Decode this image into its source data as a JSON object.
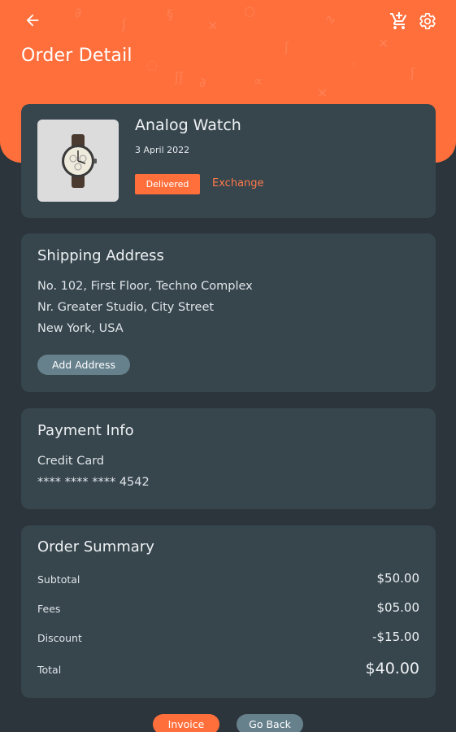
{
  "header": {
    "title": "Order Detail",
    "back_icon": "arrow-left-icon",
    "cart_icon": "cart-plus-icon",
    "settings_icon": "gear-icon",
    "accent_color": "#ff6f3c"
  },
  "product": {
    "name": "Analog Watch",
    "date": "3 April 2022",
    "status": "Delivered",
    "exchange_label": "Exchange",
    "image_icon": "watch-image"
  },
  "shipping": {
    "title": "Shipping Address",
    "lines": [
      "No. 102, First Floor, Techno Complex",
      "Nr. Greater Studio, City Street",
      "New York, USA"
    ],
    "add_address_label": "Add Address"
  },
  "payment": {
    "title": "Payment Info",
    "method": "Credit Card",
    "card_number": "**** **** **** 4542"
  },
  "summary": {
    "title": "Order Summary",
    "rows": [
      {
        "label": "Subtotal",
        "value": "$50.00"
      },
      {
        "label": "Fees",
        "value": "$05.00"
      },
      {
        "label": "Discount",
        "value": "-$15.00"
      },
      {
        "label": "Total",
        "value": "$40.00"
      }
    ]
  },
  "actions": {
    "invoice_label": "Invoice",
    "go_back_label": "Go Back"
  }
}
